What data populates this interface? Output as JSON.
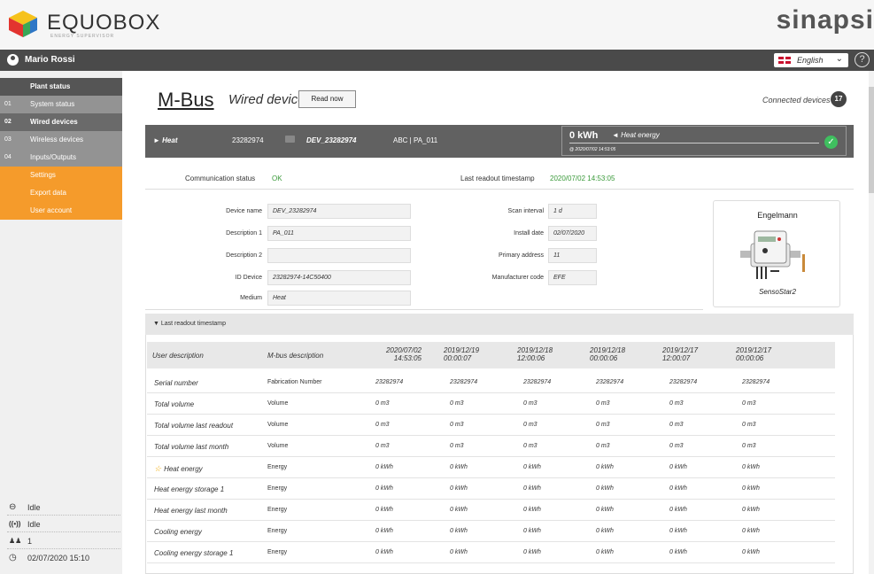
{
  "brand": {
    "name": "EQUOBOX",
    "tagline": "ENERGY SUPERVISOR",
    "partner": "sinapsi"
  },
  "user": {
    "name": "Mario Rossi"
  },
  "language": {
    "selected": "English"
  },
  "help": {
    "glyph": "?"
  },
  "sidebar": {
    "title": "Plant status",
    "items": [
      {
        "num": "01",
        "label": "System status"
      },
      {
        "num": "02",
        "label": "Wired devices"
      },
      {
        "num": "03",
        "label": "Wireless devices"
      },
      {
        "num": "04",
        "label": "Inputs/Outputs"
      }
    ],
    "orange_items": [
      {
        "label": "Settings"
      },
      {
        "label": "Export data"
      },
      {
        "label": "User account"
      }
    ],
    "status": [
      {
        "icon": "eye-icon",
        "glyph": "⊖",
        "text": "Idle"
      },
      {
        "icon": "radio-icon",
        "glyph": "((•))",
        "text": "Idle"
      },
      {
        "icon": "users-icon",
        "glyph": "♟♟",
        "text": "1"
      },
      {
        "icon": "clock-icon",
        "glyph": "◷",
        "text": "02/07/2020 15:10"
      }
    ]
  },
  "header": {
    "logo": "M-Bus",
    "subtitle": "Wired devices",
    "read_now": "Read now",
    "connected_label": "Connected devices",
    "connected_count": "17"
  },
  "device": {
    "type": "► Heat",
    "serial": "23282974",
    "name": "DEV_23282974",
    "tag": "ABC | PA_011",
    "energy_value": "0 kWh",
    "energy_label": "◄ Heat energy",
    "energy_ts": "@ 2020/07/02 14:53:05"
  },
  "info": {
    "comm_label": "Communication status",
    "comm_value": "OK",
    "readout_label": "Last readout timestamp",
    "readout_value": "2020/07/02 14:53:05"
  },
  "fields": {
    "device_name": {
      "label": "Device name",
      "value": "DEV_23282974"
    },
    "description1": {
      "label": "Description 1",
      "value": "PA_011"
    },
    "description2": {
      "label": "Description 2",
      "value": ""
    },
    "id_device": {
      "label": "ID Device",
      "value": "23282974-14C50400"
    },
    "medium": {
      "label": "Medium",
      "value": "Heat"
    },
    "scan_interval": {
      "label": "Scan interval",
      "value": "1 d"
    },
    "install_date": {
      "label": "Install date",
      "value": "02/07/2020"
    },
    "primary_address": {
      "label": "Primary address",
      "value": "11"
    },
    "manufacturer_code": {
      "label": "Manufacturer code",
      "value": "EFE"
    }
  },
  "manufacturer": {
    "name": "Engelmann",
    "model": "SensoStar2"
  },
  "readout_section": {
    "title": "▼ Last readout timestamp"
  },
  "table": {
    "headers": [
      "User description",
      "M-bus description",
      "2020/07/02 14:53:05",
      "2019/12/19 00:00:07",
      "2019/12/18 12:00:06",
      "2019/12/18 00:00:06",
      "2019/12/17 12:00:07",
      "2019/12/17 00:00:06"
    ],
    "rows": [
      {
        "user": "Serial number",
        "mbus": "Fabrication Number",
        "star": false,
        "values": [
          "23282974",
          "23282974",
          "23282974",
          "23282974",
          "23282974",
          "23282974"
        ]
      },
      {
        "user": "Total volume",
        "mbus": "Volume",
        "star": false,
        "values": [
          "0 m3",
          "0 m3",
          "0 m3",
          "0 m3",
          "0 m3",
          "0 m3"
        ]
      },
      {
        "user": "Total volume last readout",
        "mbus": "Volume",
        "star": false,
        "values": [
          "0 m3",
          "0 m3",
          "0 m3",
          "0 m3",
          "0 m3",
          "0 m3"
        ]
      },
      {
        "user": "Total volume last month",
        "mbus": "Volume",
        "star": false,
        "values": [
          "0 m3",
          "0 m3",
          "0 m3",
          "0 m3",
          "0 m3",
          "0 m3"
        ]
      },
      {
        "user": "Heat energy",
        "mbus": "Energy",
        "star": true,
        "values": [
          "0 kWh",
          "0 kWh",
          "0 kWh",
          "0 kWh",
          "0 kWh",
          "0 kWh"
        ]
      },
      {
        "user": "Heat energy storage 1",
        "mbus": "Energy",
        "star": false,
        "values": [
          "0 kWh",
          "0 kWh",
          "0 kWh",
          "0 kWh",
          "0 kWh",
          "0 kWh"
        ]
      },
      {
        "user": "Heat energy last month",
        "mbus": "Energy",
        "star": false,
        "values": [
          "0 kWh",
          "0 kWh",
          "0 kWh",
          "0 kWh",
          "0 kWh",
          "0 kWh"
        ]
      },
      {
        "user": "Cooling energy",
        "mbus": "Energy",
        "star": false,
        "values": [
          "0 kWh",
          "0 kWh",
          "0 kWh",
          "0 kWh",
          "0 kWh",
          "0 kWh"
        ]
      },
      {
        "user": "Cooling energy storage 1",
        "mbus": "Energy",
        "star": false,
        "values": [
          "0 kWh",
          "0 kWh",
          "0 kWh",
          "0 kWh",
          "0 kWh",
          "0 kWh"
        ]
      }
    ]
  }
}
